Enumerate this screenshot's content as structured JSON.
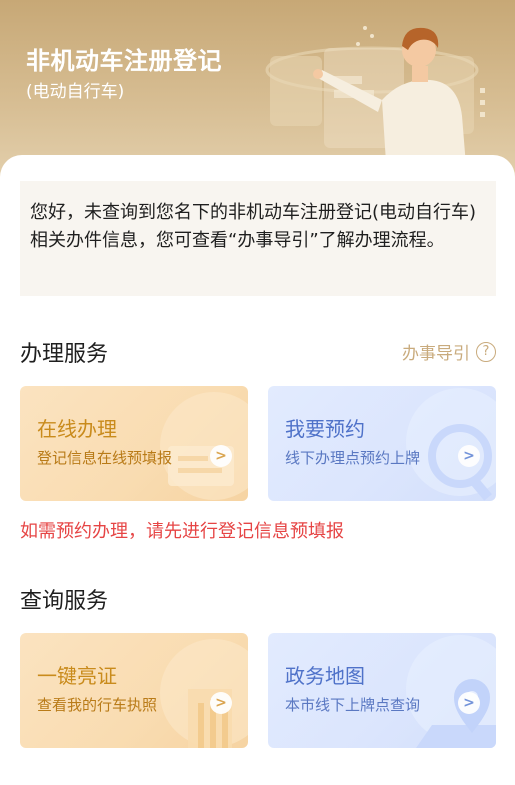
{
  "header": {
    "title": "非机动车注册登记",
    "subtitle": "(电动自行车)"
  },
  "notice": {
    "text": "您好，未查询到您名下的非机动车注册登记(电动自行车)相关办件信息，您可查看“办事导引”了解办理流程。"
  },
  "handle_section": {
    "title": "办理服务",
    "guide_label": "办事导引",
    "guide_icon": "question-circle-icon",
    "cards": [
      {
        "title": "在线办理",
        "desc": "登记信息在线预填报",
        "theme": "gold",
        "icon": "chevron-right-icon"
      },
      {
        "title": "我要预约",
        "desc": "线下办理点预约上牌",
        "theme": "blue",
        "icon": "chevron-right-icon"
      }
    ],
    "warning": "如需预约办理，请先进行登记信息预填报"
  },
  "query_section": {
    "title": "查询服务",
    "cards": [
      {
        "title": "一键亮证",
        "desc": "查看我的行车执照",
        "theme": "gold",
        "icon": "chevron-right-icon"
      },
      {
        "title": "政务地图",
        "desc": "本市线下上牌点查询",
        "theme": "blue",
        "icon": "chevron-right-icon"
      }
    ]
  },
  "colors": {
    "header_gold": "#c7a876",
    "gold_text": "#c98b1c",
    "blue_text": "#4f72c9",
    "warning_red": "#e64545",
    "guide_gold": "#c9ab7d"
  }
}
